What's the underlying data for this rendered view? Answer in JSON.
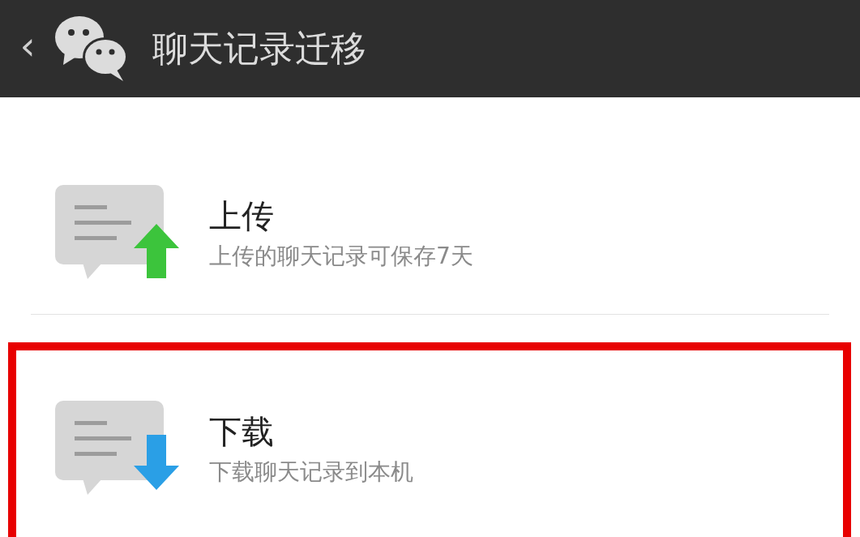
{
  "header": {
    "back": "‹",
    "title": "聊天记录迁移"
  },
  "items": [
    {
      "kind": "upload",
      "title": "上传",
      "subtitle": "上传的聊天记录可保存7天",
      "highlighted": false
    },
    {
      "kind": "download",
      "title": "下载",
      "subtitle": "下载聊天记录到本机",
      "highlighted": true
    }
  ]
}
